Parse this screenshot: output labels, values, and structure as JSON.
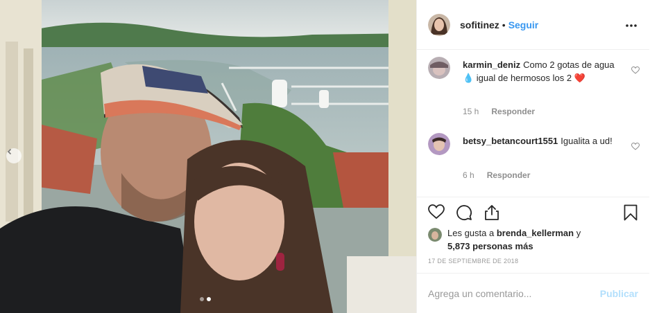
{
  "post": {
    "username": "sofitinez",
    "separator": "•",
    "follow_label": "Seguir",
    "more_icon": "more-options-icon"
  },
  "comments": [
    {
      "user": "karmin_deniz",
      "text": "Como 2 gotas de agua 💧 igual de hermosos los 2 ❤️",
      "time": "15 h",
      "reply_label": "Responder"
    },
    {
      "user": "betsy_betancourt1551",
      "text": "Igualita a ud!",
      "time": "6 h",
      "reply_label": "Responder"
    }
  ],
  "actions": {
    "like_icon": "heart-icon",
    "comment_icon": "comment-icon",
    "share_icon": "share-icon",
    "save_icon": "bookmark-icon"
  },
  "likes": {
    "prefix": "Les gusta a ",
    "user": "brenda_kellerman",
    "middle": " y ",
    "count": "5,873 personas más"
  },
  "date": "17 DE SEPTIEMBRE DE 2018",
  "add_comment": {
    "placeholder": "Agrega un comentario...",
    "post_label": "Publicar"
  },
  "carousel": {
    "slides": 2,
    "active_slide": 2
  },
  "colors": {
    "link": "#3897f0",
    "post_disabled": "#b2dffc",
    "muted": "#8e8e8e",
    "border": "#efefef"
  }
}
